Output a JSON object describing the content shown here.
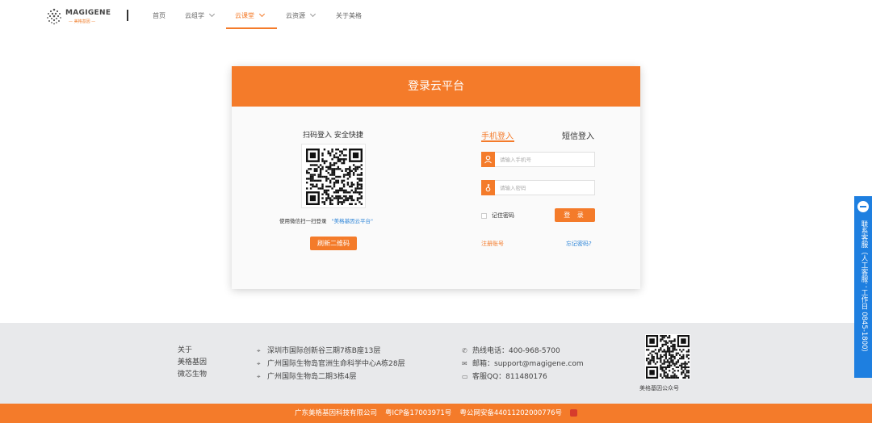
{
  "header": {
    "logo": {
      "brand": "MAGIGENE",
      "tagline": "— 美格基因 —"
    },
    "nav": [
      {
        "label": "首页"
      },
      {
        "label": "云组学"
      },
      {
        "label": "云课堂"
      },
      {
        "label": "云资源"
      },
      {
        "label": "关于美格"
      }
    ],
    "active_nav": "云课堂"
  },
  "login_card": {
    "title": "登录云平台",
    "qr": {
      "title": "扫码登入 安全快捷",
      "note": "使用微信扫一扫登录",
      "note_link": "\"美格基因云平台\"",
      "refresh_label": "刷新二维码"
    },
    "tabs": [
      {
        "label": "手机登入"
      },
      {
        "label": "短信登入"
      }
    ],
    "active_tab": "手机登入",
    "phone_placeholder": "请输入手机号",
    "password_placeholder": "请输入密码",
    "remember_label": "记住密码",
    "login_label": "登 录",
    "register_label": "注册账号",
    "forgot_label": "忘记密码?"
  },
  "footer": {
    "about": [
      "关于",
      "美格基因",
      "微芯生物"
    ],
    "addresses": [
      "深圳市国际创新谷三期7栋B座13层",
      "广州国际生物岛官洲生命科学中心A栋28层",
      "广州国际生物岛二期3栋4层"
    ],
    "contacts": [
      {
        "icon": "phone-icon",
        "text": "热线电话：400-968-5700"
      },
      {
        "icon": "mail-icon",
        "text": "邮箱：support@magigene.com"
      },
      {
        "icon": "chat-icon",
        "text": "客服QQ：811480176"
      }
    ],
    "qr_caption": "美格基因公众号",
    "company": "广东美格基因科技有限公司",
    "icp": "粤ICP备17003971号",
    "police": "粤公网安备44011202000776号"
  },
  "side_service": {
    "label": "联系客服（人工客服：工作日 0845-1800）"
  },
  "colors": {
    "accent": "#f47b2a",
    "link": "#2f86d8",
    "side": "#1e7fe0",
    "footer_bg": "#e8e9eb"
  }
}
